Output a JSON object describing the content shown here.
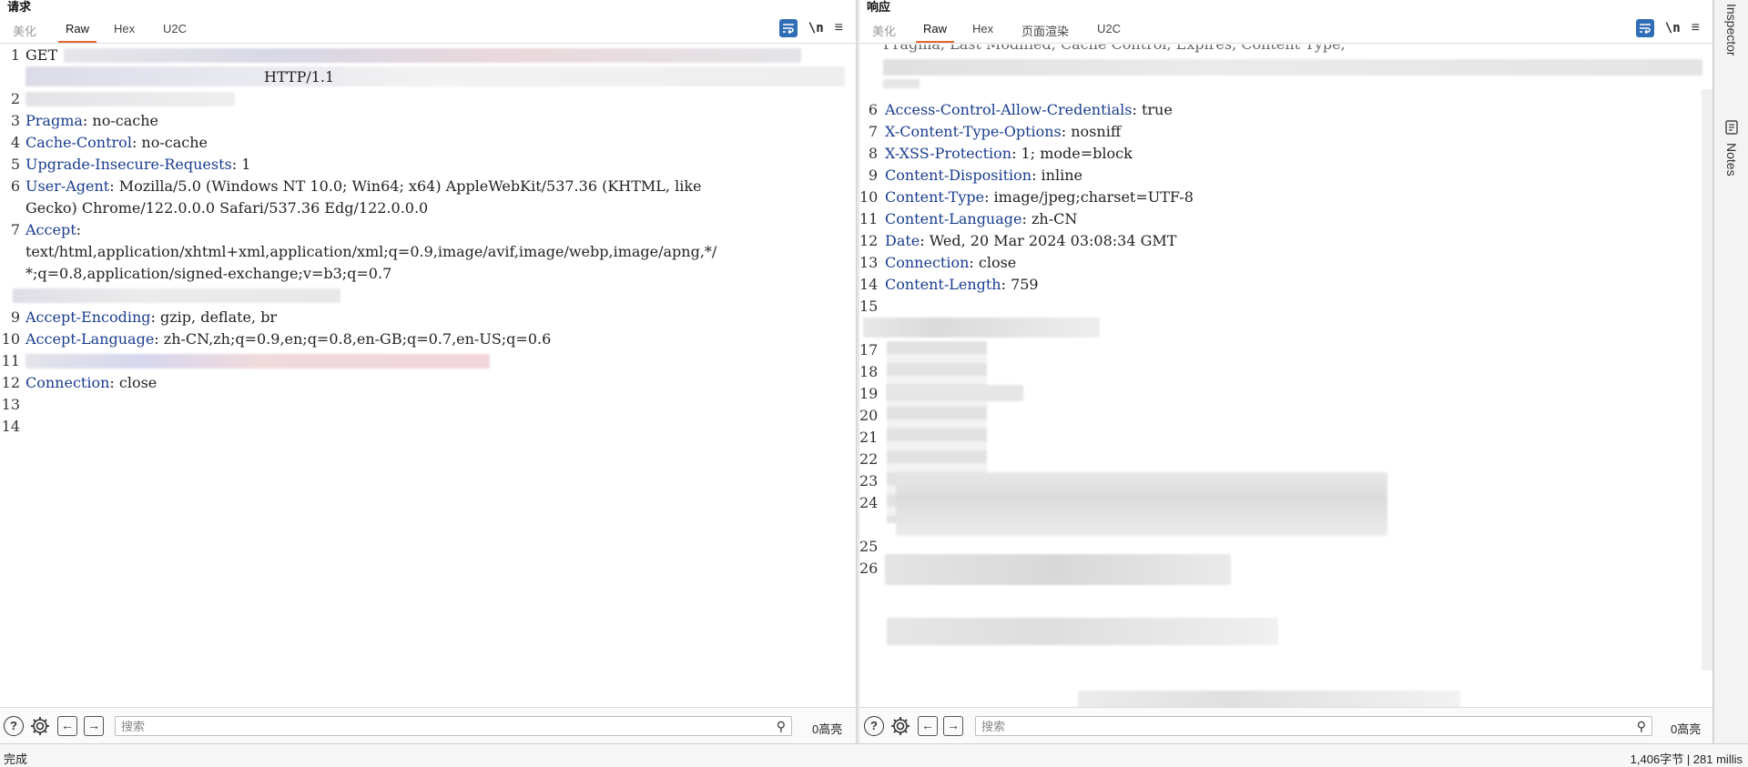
{
  "request": {
    "title": "请求",
    "tabs": [
      "美化",
      "Raw",
      "Hex",
      "U2C"
    ],
    "active_tab": "Raw",
    "tool_wrap_icon": "wrap-lines-icon",
    "tool_newline_label": "\\n",
    "tool_menu_label": "≡",
    "lines": [
      {
        "n": "1",
        "text": "GET"
      },
      {
        "n": "",
        "text": "HTTP/1.1"
      },
      {
        "n": "2",
        "text": ""
      },
      {
        "n": "3",
        "key": "Pragma",
        "val": " no-cache"
      },
      {
        "n": "4",
        "key": "Cache-Control",
        "val": " no-cache"
      },
      {
        "n": "5",
        "key": "Upgrade-Insecure-Requests",
        "val": " 1"
      },
      {
        "n": "6",
        "key": "User-Agent",
        "val": " Mozilla/5.0 (Windows NT 10.0; Win64; x64) AppleWebKit/537.36 (KHTML, like"
      },
      {
        "n": "",
        "text": "Gecko) Chrome/122.0.0.0 Safari/537.36 Edg/122.0.0.0"
      },
      {
        "n": "7",
        "key": "Accept",
        "val": ""
      },
      {
        "n": "",
        "text": "text/html,application/xhtml+xml,application/xml;q=0.9,image/avif,image/webp,image/apng,*/"
      },
      {
        "n": "",
        "text": "*;q=0.8,application/signed-exchange;v=b3;q=0.7"
      },
      {
        "n": "",
        "text": ""
      },
      {
        "n": "9",
        "key": "Accept-Encoding",
        "val": " gzip, deflate, br"
      },
      {
        "n": "10",
        "key": "Accept-Language",
        "val": " zh-CN,zh;q=0.9,en;q=0.8,en-GB;q=0.7,en-US;q=0.6"
      },
      {
        "n": "11",
        "text": ""
      },
      {
        "n": "12",
        "key": "Connection",
        "val": " close"
      },
      {
        "n": "13",
        "text": ""
      },
      {
        "n": "14",
        "text": ""
      }
    ],
    "search_placeholder": "搜索",
    "highlight_count": "0高亮"
  },
  "response": {
    "title": "响应",
    "tabs": [
      "美化",
      "Raw",
      "Hex",
      "页面渲染",
      "U2C"
    ],
    "active_tab": "Raw",
    "tool_newline_label": "\\n",
    "tool_menu_label": "≡",
    "lines": [
      {
        "n": "",
        "text": "Pragma, Last Modified, Cache Control, Expires, Content Type,"
      },
      {
        "n": "",
        "text": ""
      },
      {
        "n": "",
        "text": ""
      },
      {
        "n": "6",
        "key": "Access-Control-Allow-Credentials",
        "val": " true"
      },
      {
        "n": "7",
        "key": "X-Content-Type-Options",
        "val": " nosniff"
      },
      {
        "n": "8",
        "key": "X-XSS-Protection",
        "val": " 1; mode=block"
      },
      {
        "n": "9",
        "key": "Content-Disposition",
        "val": " inline"
      },
      {
        "n": "10",
        "key": "Content-Type",
        "val": " image/jpeg;charset=UTF-8"
      },
      {
        "n": "11",
        "key": "Content-Language",
        "val": " zh-CN"
      },
      {
        "n": "12",
        "key": "Date",
        "val": " Wed, 20 Mar 2024 03:08:34 GMT"
      },
      {
        "n": "13",
        "key": "Connection",
        "val": " close"
      },
      {
        "n": "14",
        "key": "Content-Length",
        "val": " 759"
      },
      {
        "n": "15",
        "text": ""
      },
      {
        "n": "",
        "text": ""
      },
      {
        "n": "17",
        "text": ""
      },
      {
        "n": "18",
        "text": ""
      },
      {
        "n": "19",
        "text": ""
      },
      {
        "n": "20",
        "text": ""
      },
      {
        "n": "21",
        "text": ""
      },
      {
        "n": "22",
        "text": ""
      },
      {
        "n": "23",
        "text": ""
      },
      {
        "n": "24",
        "text": ""
      },
      {
        "n": "",
        "text": ""
      },
      {
        "n": "25",
        "text": ""
      },
      {
        "n": "26",
        "text": ""
      }
    ],
    "search_placeholder": "搜索",
    "highlight_count": "0高亮"
  },
  "sidebar": {
    "items": [
      {
        "label": "Inspector",
        "icon": "inspector-icon"
      },
      {
        "label": "Notes",
        "icon": "notes-icon"
      }
    ]
  },
  "status": {
    "left": "完成",
    "right": "1,406字节 | 281 millis"
  },
  "icons": {
    "help": "help-icon",
    "settings": "gear-icon",
    "back": "arrow-left-icon",
    "forward": "arrow-right-icon",
    "search": "search-icon"
  },
  "colors": {
    "accent_tab": "#e8682c",
    "header_key": "#1a3d8f",
    "tool_blue": "#2f6db5"
  }
}
